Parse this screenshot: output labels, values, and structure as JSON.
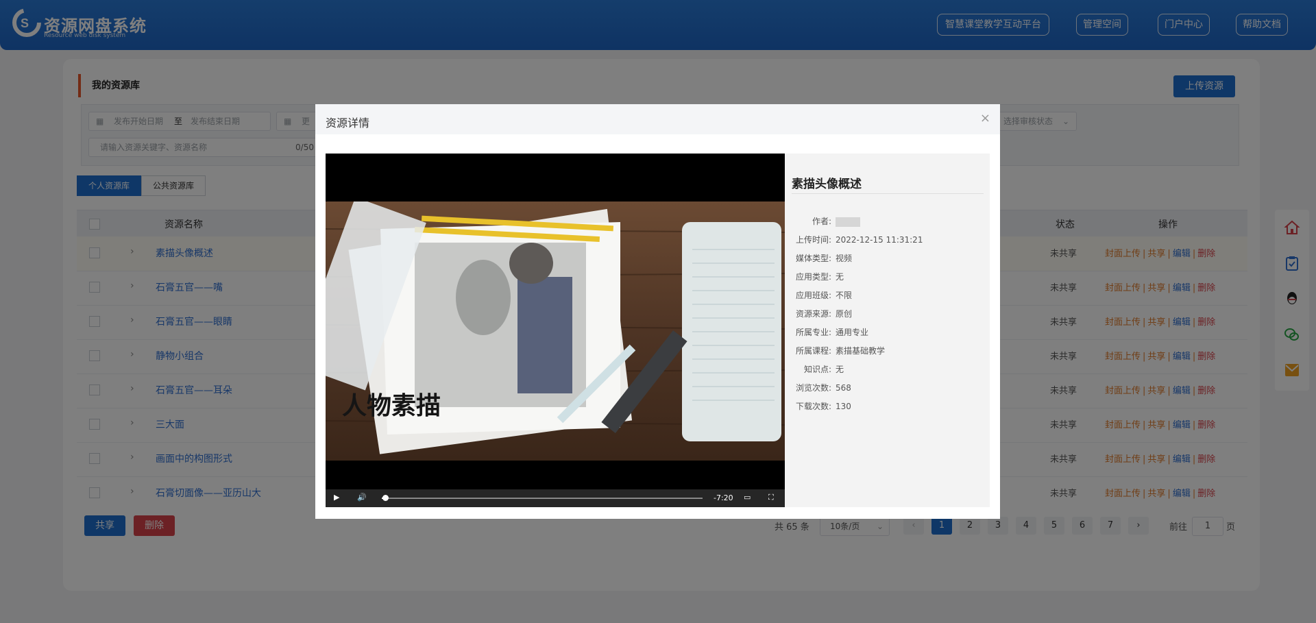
{
  "header": {
    "logo_title": "资源网盘系统",
    "logo_sub": "Resource web disk system",
    "nav": [
      "智慧课堂教学互动平台",
      "管理空间",
      "门户中心",
      "帮助文档"
    ]
  },
  "main": {
    "section_title": "我的资源库",
    "upload_label": "上传资源",
    "filters": {
      "start_date_placeholder": "发布开始日期",
      "to_label": "至",
      "end_date_placeholder": "发布结束日期",
      "update_date_placeholder_partial": "更",
      "audit_status_placeholder": "选择审核状态",
      "keyword_placeholder": "请输入资源关键字、资源名称",
      "keyword_counter": "0/50"
    },
    "tabs": [
      "个人资源库",
      "公共资源库"
    ],
    "table": {
      "headers": {
        "name": "资源名称",
        "status": "状态",
        "ops": "操作"
      },
      "ops": {
        "cover": "封面上传",
        "share": "共享",
        "edit": "编辑",
        "delete": "删除",
        "sep": "|"
      },
      "rows": [
        {
          "name": "素描头像概述",
          "status": "未共享"
        },
        {
          "name": "石膏五官——嘴",
          "status": "未共享"
        },
        {
          "name": "石膏五官——眼睛",
          "status": "未共享"
        },
        {
          "name": "静物小组合",
          "status": "未共享"
        },
        {
          "name": "石膏五官——耳朵",
          "status": "未共享"
        },
        {
          "name": "三大面",
          "status": "未共享"
        },
        {
          "name": "画面中的构图形式",
          "status": "未共享"
        },
        {
          "name": "石膏切面像——亚历山大",
          "status": "未共享"
        }
      ]
    },
    "bottom": {
      "share_label": "共享",
      "delete_label": "删除"
    },
    "pager": {
      "total": "共 65 条",
      "page_size": "10条/页",
      "pages": [
        "1",
        "2",
        "3",
        "4",
        "5",
        "6",
        "7"
      ],
      "goto_prefix": "前往",
      "goto_value": "1",
      "goto_suffix": "页"
    }
  },
  "modal": {
    "title": "资源详情",
    "close": "×",
    "video": {
      "overlay_text": "人物素描",
      "time_remaining": "-7:20",
      "progress": 0.01
    },
    "info": {
      "name": "素描头像概述",
      "fields": [
        {
          "k": "作者:",
          "v": ""
        },
        {
          "k": "上传时间:",
          "v": "2022-12-15 11:31:21"
        },
        {
          "k": "媒体类型:",
          "v": "视频"
        },
        {
          "k": "应用类型:",
          "v": "无"
        },
        {
          "k": "应用班级:",
          "v": "不限"
        },
        {
          "k": "资源来源:",
          "v": "原创"
        },
        {
          "k": "所属专业:",
          "v": "通用专业"
        },
        {
          "k": "所属课程:",
          "v": "素描基础教学"
        },
        {
          "k": "知识点:",
          "v": "无"
        },
        {
          "k": "浏览次数:",
          "v": "568"
        },
        {
          "k": "下载次数:",
          "v": "130"
        }
      ]
    }
  },
  "colors": {
    "primary": "#1e6fcf",
    "accent_orange": "#e07b2a",
    "danger": "#d9434a"
  }
}
